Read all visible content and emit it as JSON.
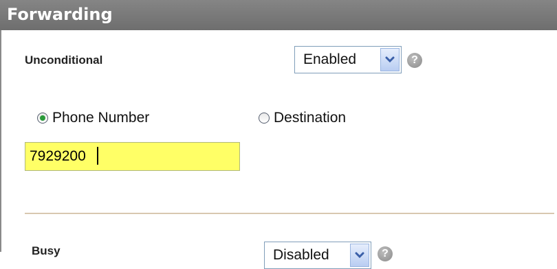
{
  "section": {
    "title": "Forwarding"
  },
  "unconditional": {
    "label": "Unconditional",
    "select_value": "Enabled",
    "help_glyph": "?",
    "options": {
      "phone_number_label": "Phone Number",
      "destination_label": "Destination",
      "selected": "Phone Number"
    },
    "phone_number_value": "7929200"
  },
  "busy": {
    "label": "Busy",
    "select_value": "Disabled",
    "help_glyph": "?"
  },
  "colors": {
    "header_bg": "#7a7a7a",
    "input_highlight": "#ffff66",
    "radio_checked": "#2a9a3a"
  }
}
